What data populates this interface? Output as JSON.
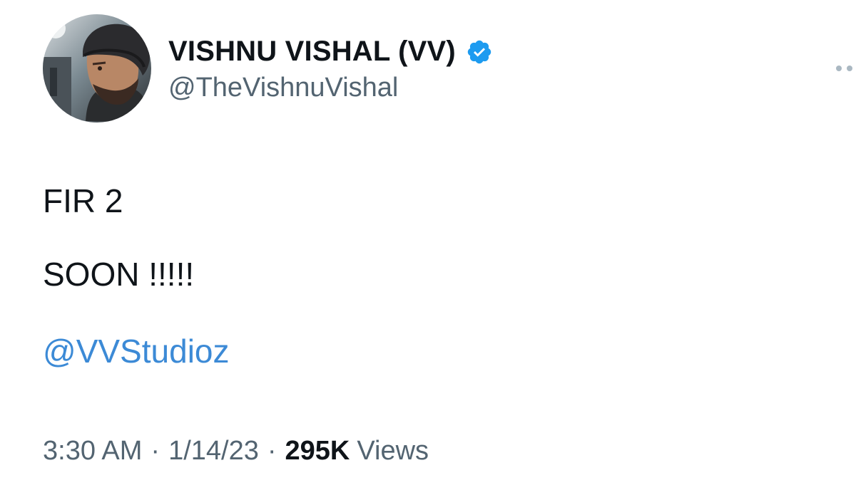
{
  "author": {
    "display_name": "VISHNU VISHAL (VV)",
    "handle": "@TheVishnuVishal",
    "verified_icon": "verified-badge-icon",
    "avatar": "profile-photo"
  },
  "tweet": {
    "lines": [
      "FIR 2",
      "SOON !!!!!"
    ],
    "mention": "@VVStudioz"
  },
  "meta": {
    "time": "3:30 AM",
    "separator": "·",
    "date": "1/14/23",
    "views_count": "295K",
    "views_label": "Views"
  },
  "colors": {
    "text": "#0f1419",
    "secondary": "#536471",
    "link": "#3c8ad6",
    "verified": "#1d9bf0"
  },
  "icons": {
    "more": "more-options-icon"
  }
}
